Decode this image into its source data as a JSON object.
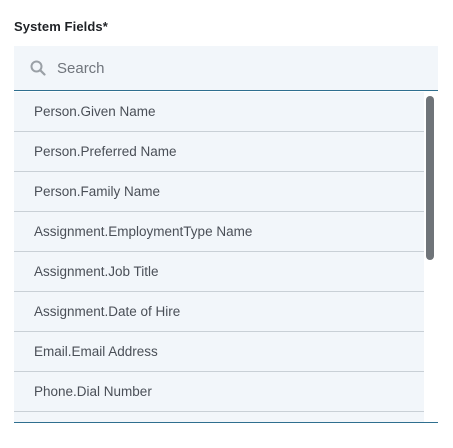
{
  "section": {
    "label": "System Fields*"
  },
  "search": {
    "placeholder": "Search",
    "value": "",
    "icon": "search-icon"
  },
  "fields": [
    {
      "label": "Person.Given Name"
    },
    {
      "label": "Person.Preferred Name"
    },
    {
      "label": "Person.Family Name"
    },
    {
      "label": "Assignment.EmploymentType Name"
    },
    {
      "label": "Assignment.Job Title"
    },
    {
      "label": "Assignment.Date of Hire"
    },
    {
      "label": "Email.Email Address"
    },
    {
      "label": "Phone.Dial Number"
    },
    {
      "label": ""
    }
  ],
  "colors": {
    "accent_border": "#2f6f8f",
    "row_background": "#f2f6fa",
    "row_divider": "#c9d0d6",
    "scrollbar_thumb": "#6f7479"
  }
}
